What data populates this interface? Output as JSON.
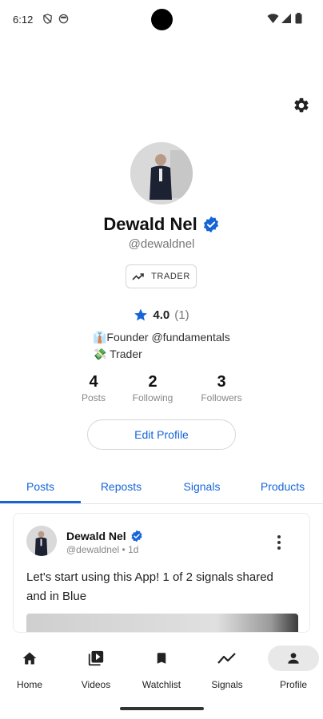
{
  "status_bar": {
    "time": "6:12"
  },
  "profile": {
    "name": "Dewald Nel",
    "handle": "@dewaldnel",
    "badge_label": "TRADER",
    "rating_value": "4.0",
    "rating_count": "(1)",
    "bio_lines": [
      "👔Founder @fundamentals",
      "💸 Trader"
    ],
    "stats": [
      {
        "value": "4",
        "label": "Posts"
      },
      {
        "value": "2",
        "label": "Following"
      },
      {
        "value": "3",
        "label": "Followers"
      }
    ],
    "edit_button_label": "Edit Profile"
  },
  "tabs": [
    {
      "label": "Posts",
      "active": true
    },
    {
      "label": "Reposts"
    },
    {
      "label": "Signals"
    },
    {
      "label": "Products"
    }
  ],
  "post": {
    "author_name": "Dewald Nel",
    "author_meta": "@dewaldnel • 1d",
    "text": "Let's start using this App! 1 of 2 signals shared and in Blue"
  },
  "bottom_nav": [
    {
      "label": "Home",
      "icon": "home-icon"
    },
    {
      "label": "Videos",
      "icon": "video-library-icon"
    },
    {
      "label": "Watchlist",
      "icon": "bookmark-icon"
    },
    {
      "label": "Signals",
      "icon": "trending-icon"
    },
    {
      "label": "Profile",
      "icon": "person-icon",
      "active": true
    }
  ],
  "colors": {
    "accent": "#1565d8",
    "verified": "#1565d8"
  }
}
